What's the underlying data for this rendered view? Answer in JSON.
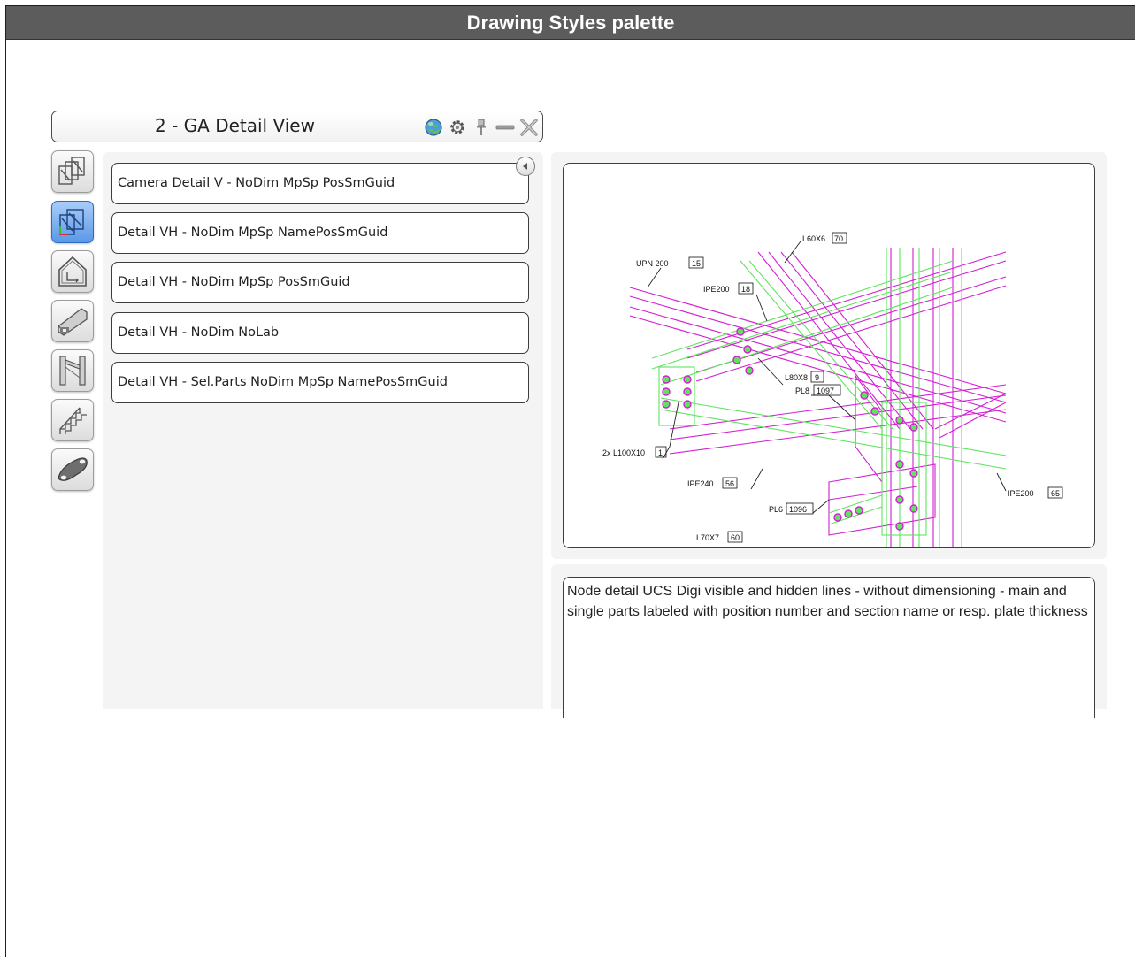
{
  "page": {
    "title": "Drawing Styles palette"
  },
  "palette": {
    "title": "2 - GA Detail View",
    "header_icons": [
      "globe-icon",
      "gear-icon",
      "pin-icon",
      "minimize-icon",
      "close-icon"
    ]
  },
  "side_tabs": [
    {
      "name": "model-views-tab",
      "icon": "stacked-frames-icon",
      "active": false
    },
    {
      "name": "detail-views-tab",
      "icon": "detail-frame-icon",
      "active": true
    },
    {
      "name": "building-views-tab",
      "icon": "house-outline-icon",
      "active": false
    },
    {
      "name": "beam-views-tab",
      "icon": "beam-icon",
      "active": false
    },
    {
      "name": "frame-views-tab",
      "icon": "frame-icon",
      "active": false
    },
    {
      "name": "stair-views-tab",
      "icon": "stair-icon",
      "active": false
    },
    {
      "name": "plate-views-tab",
      "icon": "plate-icon",
      "active": false
    }
  ],
  "styles": [
    "Camera Detail V - NoDim MpSp PosSmGuid",
    "Detail VH - NoDim MpSp NamePosSmGuid",
    "Detail VH - NoDim MpSp PosSmGuid",
    "Detail VH - NoDim NoLab",
    "Detail VH - Sel.Parts NoDim MpSp NamePosSmGuid"
  ],
  "preview": {
    "labels": [
      {
        "text": "L60X6",
        "pos": "70"
      },
      {
        "text": "UPN 200",
        "pos": "15"
      },
      {
        "text": "IPE200",
        "pos": "18"
      },
      {
        "text": "L80X8",
        "pos": "9"
      },
      {
        "text": "PL8",
        "pos": "1097"
      },
      {
        "text": "2x L100X10",
        "pos": "1"
      },
      {
        "text": "IPE240",
        "pos": "56"
      },
      {
        "text": "IPE200",
        "pos": "65"
      },
      {
        "text": "PL6",
        "pos": "1096"
      },
      {
        "text": "L70X7",
        "pos": "60"
      }
    ]
  },
  "description": "Node detail UCS Digi visible and hidden lines - without dimensioning - main and single parts labeled with position number and section name or resp. plate thickness",
  "colors": {
    "title_bar": "#5c5c5c",
    "active_tab": "#5a98e6",
    "magenta": "#d21fd2",
    "green": "#5fe35f"
  }
}
